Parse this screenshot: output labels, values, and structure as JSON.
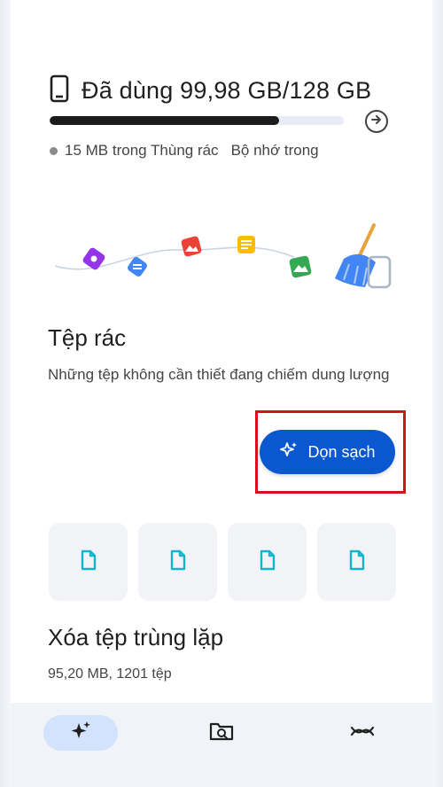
{
  "storage": {
    "title": "Đã dùng 99,98 GB/128 GB",
    "used_fraction": 0.78,
    "trash_text": "15 MB trong Thùng rác",
    "location": "Bộ nhớ trong"
  },
  "junk": {
    "title": "Tệp rác",
    "description": "Những tệp không cần thiết đang chiếm dung lượng",
    "clean_label": "Dọn sạch"
  },
  "thumbnails": [
    {
      "icon": "document-icon"
    },
    {
      "icon": "document-icon"
    },
    {
      "icon": "document-icon"
    },
    {
      "icon": "document-icon"
    }
  ],
  "duplicates": {
    "title": "Xóa tệp trùng lặp",
    "summary": "95,20 MB, 1201 tệp"
  },
  "nav": {
    "items": [
      {
        "icon": "sparkle-icon",
        "active": true
      },
      {
        "icon": "browse-folder-icon",
        "active": false
      },
      {
        "icon": "share-icon",
        "active": false
      }
    ]
  },
  "colors": {
    "accent": "#0b57d0",
    "highlight": "#d3131c",
    "progress": "#1b1b1b",
    "nav_active": "#d3e3fd",
    "thumb_icon": "#12b5cb"
  }
}
